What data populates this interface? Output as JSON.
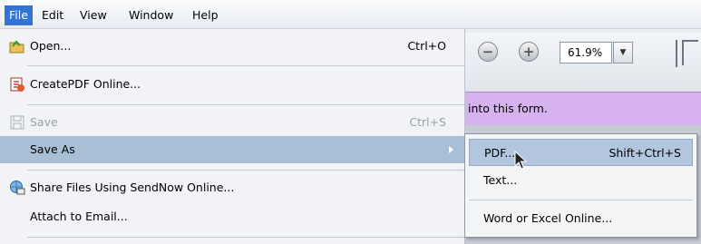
{
  "menubar": {
    "items": [
      {
        "label": "File"
      },
      {
        "label": "Edit"
      },
      {
        "label": "View"
      },
      {
        "label": "Window"
      },
      {
        "label": "Help"
      }
    ]
  },
  "file_menu": {
    "open": {
      "label": "Open...",
      "shortcut": "Ctrl+O",
      "icon": "open-folder-icon"
    },
    "create_pdf": {
      "label": "CreatePDF Online...",
      "icon": "create-pdf-icon"
    },
    "save": {
      "label": "Save",
      "shortcut": "Ctrl+S",
      "icon": "save-disk-icon",
      "disabled": true
    },
    "save_as": {
      "label": "Save As"
    },
    "share": {
      "label": "Share Files Using SendNow Online...",
      "icon": "share-globe-icon"
    },
    "attach": {
      "label": "Attach to Email..."
    }
  },
  "save_as_submenu": {
    "pdf": {
      "label": "PDF...",
      "shortcut": "Shift+Ctrl+S"
    },
    "text": {
      "label": "Text..."
    },
    "word_excel": {
      "label": "Word or Excel Online..."
    }
  },
  "toolbar": {
    "zoom_value": "61.9%"
  },
  "document": {
    "form_notice": "into this form."
  },
  "colors": {
    "menu_highlight": "#3373d6",
    "row_highlight": "#a9bfd6",
    "form_bar": "#d6b2ef"
  }
}
